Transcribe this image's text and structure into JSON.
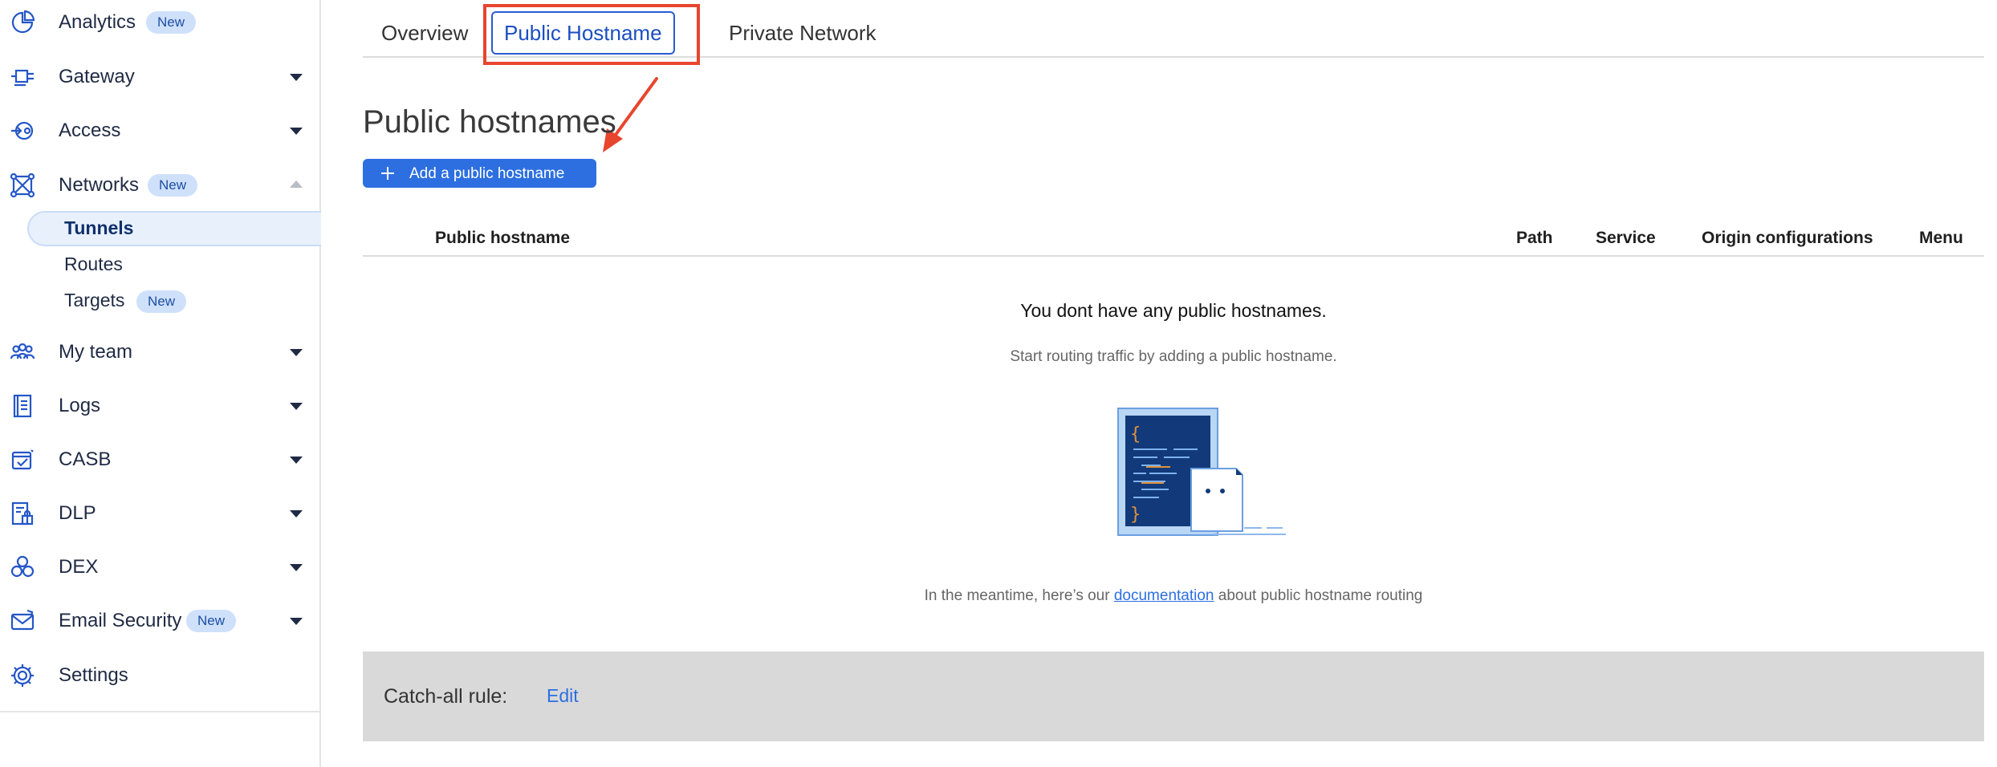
{
  "sidebar": {
    "items": [
      {
        "label": "Analytics",
        "badge": "New",
        "icon": "analytics-pie-icon"
      },
      {
        "label": "Gateway",
        "icon": "gateway-icon"
      },
      {
        "label": "Access",
        "icon": "access-icon"
      },
      {
        "label": "Networks",
        "badge": "New",
        "icon": "networks-icon",
        "expanded": true
      },
      {
        "label": "My team",
        "icon": "team-icon"
      },
      {
        "label": "Logs",
        "icon": "logs-icon"
      },
      {
        "label": "CASB",
        "icon": "casb-icon"
      },
      {
        "label": "DLP",
        "icon": "dlp-icon"
      },
      {
        "label": "DEX",
        "icon": "dex-icon"
      },
      {
        "label": "Email Security",
        "badge": "New",
        "icon": "email-security-icon"
      },
      {
        "label": "Settings",
        "icon": "gear-icon"
      }
    ],
    "networks_sub": [
      {
        "label": "Tunnels",
        "active": true
      },
      {
        "label": "Routes"
      },
      {
        "label": "Targets",
        "badge": "New"
      }
    ]
  },
  "tabs": {
    "overview": "Overview",
    "public_hostname": "Public Hostname",
    "private_network": "Private Network",
    "active": "Public Hostname"
  },
  "main": {
    "title": "Public hostnames",
    "add_button": "Add a public hostname",
    "table_headers": {
      "hostname": "Public hostname",
      "path": "Path",
      "service": "Service",
      "origin": "Origin configurations",
      "menu": "Menu"
    },
    "empty_title": "You dont have any public hostnames.",
    "empty_subtitle": "Start routing traffic by adding a public hostname.",
    "doc_prefix": "In the meantime, here’s our ",
    "doc_link": "documentation",
    "doc_suffix": " about public hostname routing",
    "catchall_label": "Catch-all rule:",
    "catchall_edit": "Edit"
  },
  "colors": {
    "accent": "#2d6fe0",
    "annotation": "#e8452f",
    "badge_bg": "#cfe0fb"
  }
}
